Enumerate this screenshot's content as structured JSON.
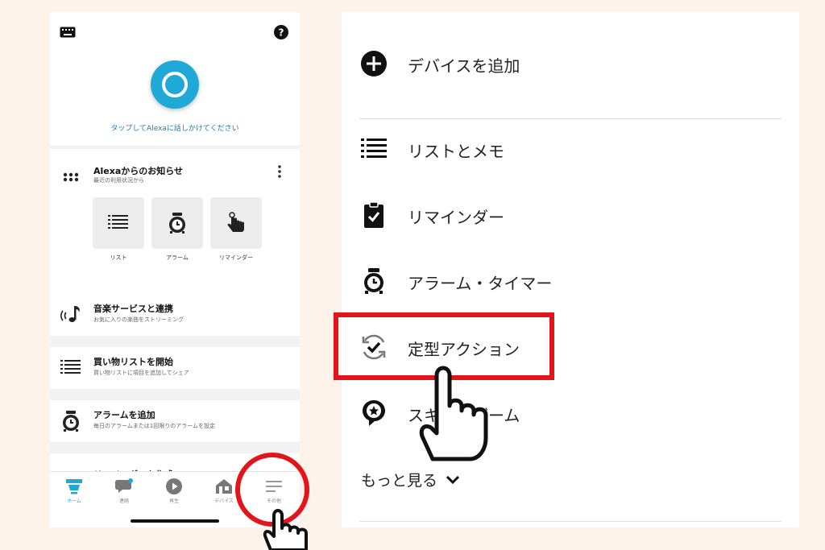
{
  "phone": {
    "alexa_hint": "タップしてAlexaに話しかけてください",
    "notice": {
      "title": "Alexaからのお知らせ",
      "subtitle": "最近の利用状況から",
      "tiles": [
        {
          "label": "リスト",
          "icon": "list-icon"
        },
        {
          "label": "アラーム",
          "icon": "alarm-icon"
        },
        {
          "label": "リマインダー",
          "icon": "reminder-hand-icon"
        }
      ]
    },
    "rows": [
      {
        "title": "音楽サービスと連携",
        "subtitle": "お気に入りの楽曲をストリーミング",
        "icon": "music-note-icon"
      },
      {
        "title": "買い物リストを開始",
        "subtitle": "買い物リストに項目を追加してシェア",
        "icon": "list-icon"
      },
      {
        "title": "アラームを追加",
        "subtitle": "毎日のアラームまたは1回限りのアラームを設定",
        "icon": "alarm-icon"
      },
      {
        "title": "リマインダーを作成",
        "subtitle": "",
        "icon": "reminder-icon"
      }
    ],
    "tabs": [
      {
        "label": "ホーム",
        "icon": "home-icon",
        "active": true
      },
      {
        "label": "連絡",
        "icon": "chat-icon",
        "active": false
      },
      {
        "label": "再生",
        "icon": "play-icon",
        "active": false
      },
      {
        "label": "デバイス",
        "icon": "devices-icon",
        "active": false
      },
      {
        "label": "その他",
        "icon": "menu-icon",
        "active": false
      }
    ],
    "accent_color": "#1fa9d6"
  },
  "menu": {
    "items": [
      {
        "label": "デバイスを追加",
        "icon": "plus-circle-icon"
      },
      {
        "label": "リストとメモ",
        "icon": "list-icon"
      },
      {
        "label": "リマインダー",
        "icon": "clipboard-check-icon"
      },
      {
        "label": "アラーム・タイマー",
        "icon": "alarm-icon"
      },
      {
        "label": "定型アクション",
        "icon": "routine-icon"
      },
      {
        "label": "スキル・ゲーム",
        "icon": "skill-icon"
      }
    ],
    "more_label": "もっと見る"
  },
  "highlight_color": "#e2151b"
}
